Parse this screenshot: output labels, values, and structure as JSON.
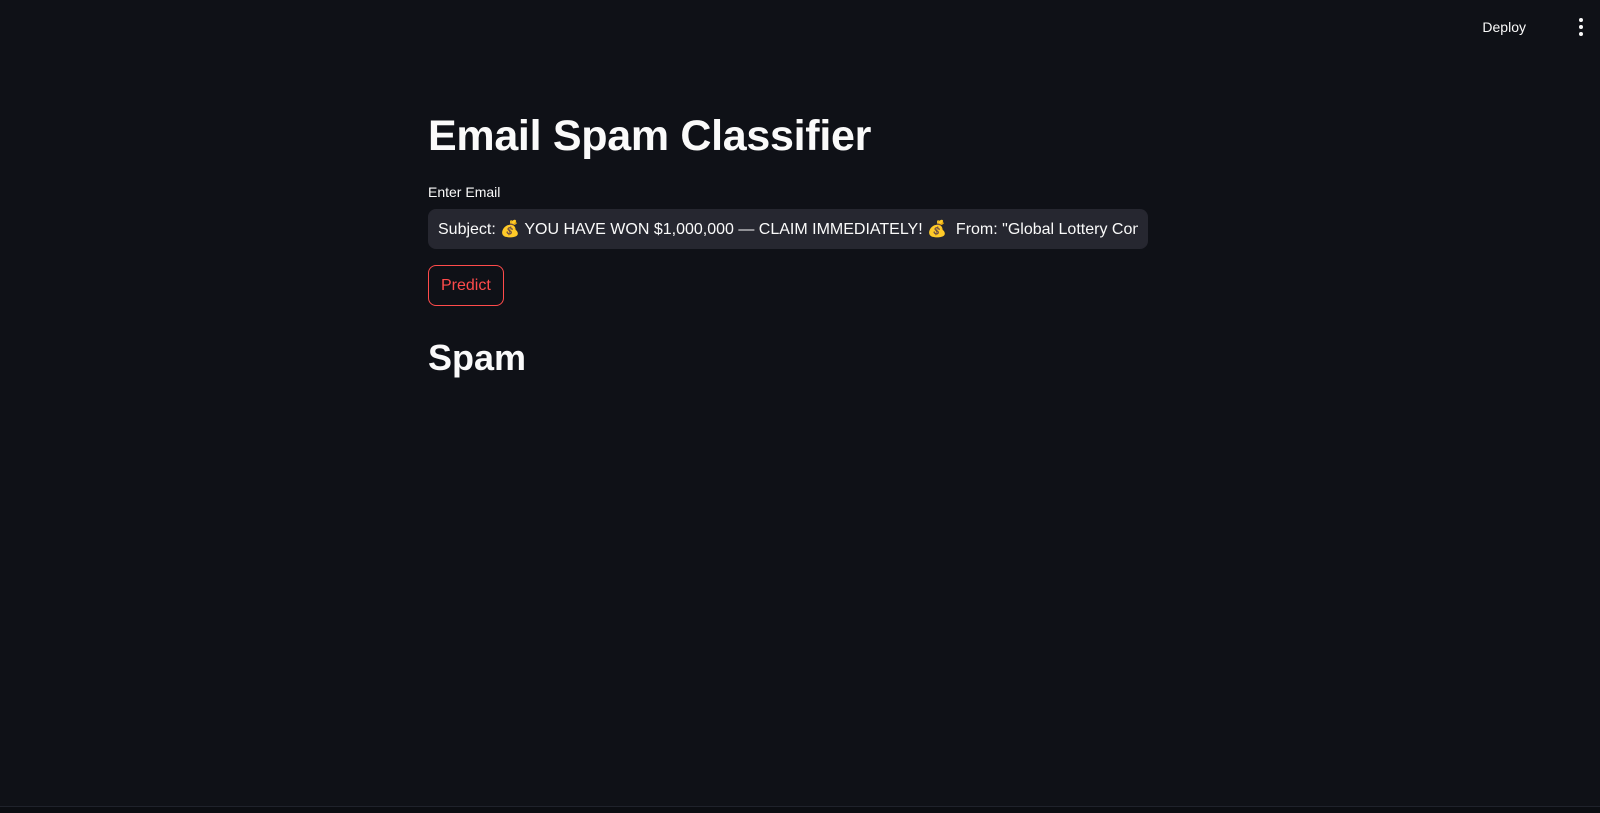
{
  "header": {
    "deploy_label": "Deploy",
    "menu_icon": "vertical-ellipsis-icon"
  },
  "main": {
    "title": "Email Spam Classifier",
    "input": {
      "label": "Enter Email",
      "value": "Subject: 💰 YOU HAVE WON $1,000,000 — CLAIM IMMEDIATELY! 💰  From: \"Global Lottery Commission\" <"
    },
    "predict_label": "Predict",
    "result": "Spam"
  },
  "colors": {
    "background": "#0f1117",
    "input_background": "#262730",
    "accent": "#ff4b4b",
    "text": "#fafafa"
  }
}
